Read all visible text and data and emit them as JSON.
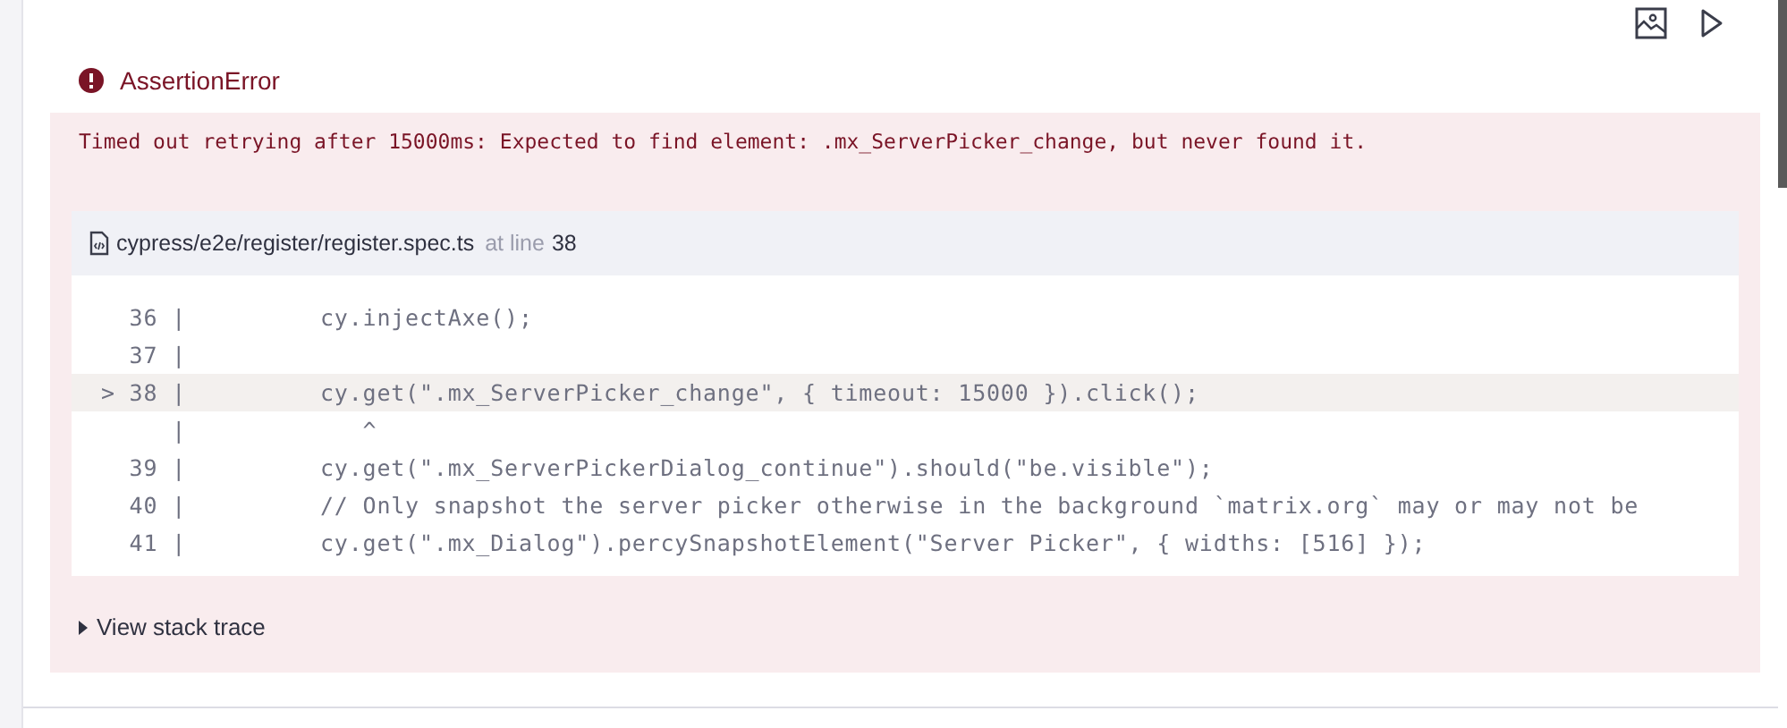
{
  "error": {
    "title": "AssertionError",
    "message": "Timed out retrying after 15000ms: Expected to find element: .mx_ServerPicker_change, but never found it."
  },
  "file": {
    "path": "cypress/e2e/register/register.spec.ts",
    "at_label": "at line",
    "line": "38"
  },
  "code_lines": [
    {
      "gutter": "36 |",
      "code": "cy.injectAxe();",
      "highlighted": false
    },
    {
      "gutter": "37 |",
      "highlighted": false
    },
    {
      "gutter": "> 38 |",
      "code": "cy.get(\".mx_ServerPicker_change\", { timeout: 15000 }).click();",
      "highlighted": true
    },
    {
      "gutter": "|",
      "code": "   ^",
      "highlighted": false
    },
    {
      "gutter": "39 |",
      "code": "cy.get(\".mx_ServerPickerDialog_continue\").should(\"be.visible\");",
      "highlighted": false
    },
    {
      "gutter": "40 |",
      "code": "// Only snapshot the server picker otherwise in the background `matrix.org` may or may not be",
      "highlighted": false
    },
    {
      "gutter": "41 |",
      "code": "cy.get(\".mx_Dialog\").percySnapshotElement(\"Server Picker\", { widths: [516] });",
      "highlighted": false
    }
  ],
  "stack_trace_toggle": {
    "label": "View stack trace",
    "expanded": false
  }
}
